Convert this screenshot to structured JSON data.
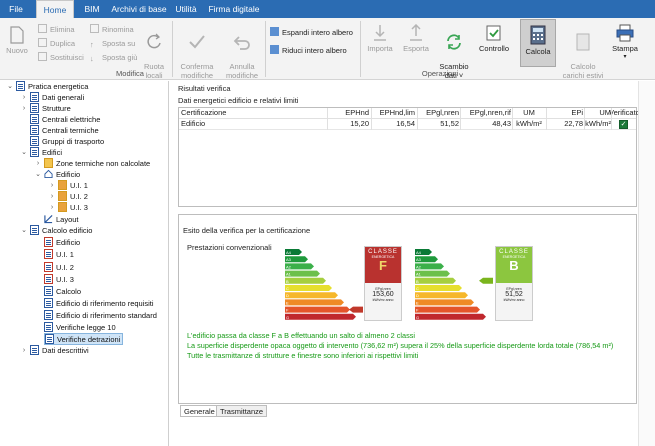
{
  "menu": {
    "tabs": [
      {
        "label": "File"
      },
      {
        "label": "Home"
      },
      {
        "label": "BIM"
      },
      {
        "label": "Archivi di base"
      },
      {
        "label": "Utilità"
      },
      {
        "label": "Firma digitale"
      }
    ]
  },
  "ribbon": {
    "nuovo": "Nuovo",
    "elimina": "Elimina",
    "duplica": "Duplica",
    "sostituisci": "Sostituisci",
    "rinomina": "Rinomina",
    "sposta_su": "Sposta su",
    "sposta_giu": "Sposta giù",
    "ruota_locali": "Ruota\nlocali",
    "conferma": "Conferma\nmodifiche",
    "annulla": "Annulla\nmodifiche",
    "espandi": "Espandi intero albero",
    "riduci": "Riduci intero albero",
    "importa": "Importa",
    "esporta": "Esporta",
    "scambio": "Scambio\ndati ˅",
    "controllo": "Controllo",
    "calcola": "Calcola",
    "calcolo_carichi": "Calcolo\ncarichi estivi",
    "stampa": "Stampa",
    "group_modifica": "Modifica",
    "group_operazioni": "Operazioni"
  },
  "tree": {
    "items": [
      {
        "label": "Pratica energetica"
      },
      {
        "label": "Dati generali"
      },
      {
        "label": "Strutture"
      },
      {
        "label": "Centrali elettriche"
      },
      {
        "label": "Centrali termiche"
      },
      {
        "label": "Gruppi di trasporto"
      },
      {
        "label": "Edifici"
      },
      {
        "label": "Zone termiche non calcolate"
      },
      {
        "label": "Edificio"
      },
      {
        "label": "U.I. 1"
      },
      {
        "label": "U.I. 2"
      },
      {
        "label": "U.I. 3"
      },
      {
        "label": "Layout"
      },
      {
        "label": "Calcolo edificio"
      },
      {
        "label": "Edificio"
      },
      {
        "label": "U.I. 1"
      },
      {
        "label": "U.I. 2"
      },
      {
        "label": "U.I. 3"
      },
      {
        "label": "Calcolo"
      },
      {
        "label": "Edificio di riferimento requisiti"
      },
      {
        "label": "Edificio di riferimento standard"
      },
      {
        "label": "Verifiche legge 10"
      },
      {
        "label": "Verifiche detrazioni"
      },
      {
        "label": "Dati descrittivi"
      }
    ]
  },
  "main": {
    "section_title": "Risultati verifica",
    "subsection_title": "Dati energetici edificio e relativi limiti",
    "table": {
      "headers": [
        "Certificazione",
        "EPHnd",
        "EPHnd,lim",
        "EPgl,nren",
        "EPgl,nren,rif",
        "UM",
        "EPi",
        "UM",
        "Verificato"
      ],
      "row": [
        "Edificio",
        "15,20",
        "16,54",
        "51,52",
        "48,43",
        "kWh/m²",
        "22,78",
        "kWh/m²",
        "✓"
      ]
    },
    "esito_title": "Esito della verifica per la certificazione",
    "prestazioni": "Prestazioni convenzionali",
    "classe_word": "CLASSE",
    "energetica_word": "ENERGETICA",
    "classe_before": "F",
    "value_before": "153,60",
    "classe_after": "B",
    "value_after": "51,52",
    "unit": "kWh/m² anno",
    "eplabel": "EPgl,nren",
    "scale_letters": [
      "A4",
      "A3",
      "A2",
      "A1",
      "B",
      "C",
      "D",
      "E",
      "F",
      "G"
    ],
    "messages": [
      "L'edificio passa da classe F a B effettuando un salto di almeno 2 classi",
      "La superficie disperdente opaca oggetto di intervento (736,62 m²) supera il 25% della superficie disperdente lorda totale (786,54 m²)",
      "Tutte le trasmittanze di strutture e finestre sono inferiori ai rispettivi limiti"
    ],
    "bottom_tabs": [
      "Generale",
      "Trasmittanze"
    ]
  },
  "colors": {
    "menubar": "#2b6cb3",
    "class_before": "#b9322f",
    "class_after": "#8cc63f",
    "arrow_red": "#c0392b",
    "arrow_green": "#7ab51d",
    "message_green": "#169a16"
  }
}
